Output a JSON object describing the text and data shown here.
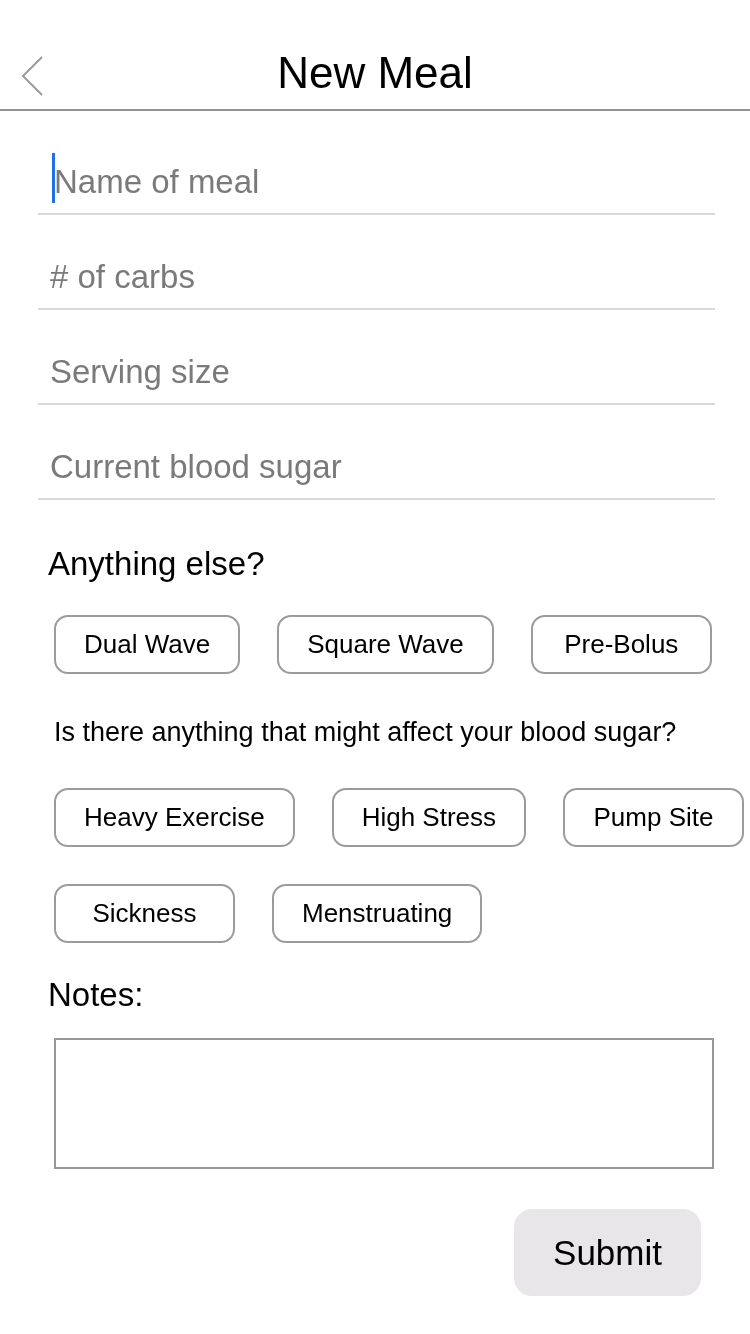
{
  "header": {
    "title": "New Meal"
  },
  "fields": [
    {
      "placeholder": "Name of meal",
      "focused": true
    },
    {
      "placeholder": "# of carbs",
      "focused": false
    },
    {
      "placeholder": "Serving size",
      "focused": false
    },
    {
      "placeholder": "Current blood sugar",
      "focused": false
    }
  ],
  "extras": {
    "label": "Anything else?",
    "options": [
      "Dual Wave",
      "Square Wave",
      "Pre-Bolus"
    ]
  },
  "factors": {
    "question": "Is there anything that might affect your blood sugar?",
    "options": [
      "Heavy Exercise",
      "High Stress",
      "Pump Site",
      "Sickness",
      "Menstruating"
    ]
  },
  "notes": {
    "label": "Notes:"
  },
  "submit": {
    "label": "Submit"
  }
}
